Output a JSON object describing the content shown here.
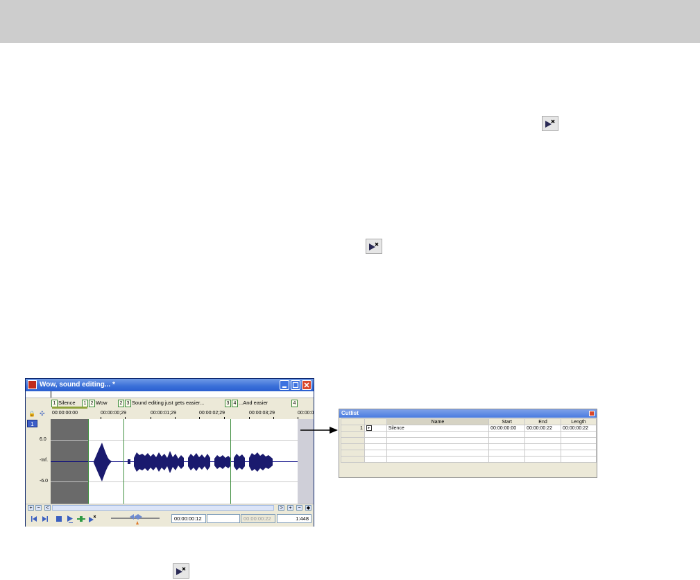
{
  "toolbar_icon": "play-with-x-icon",
  "editor": {
    "title": "Wow, sound editing... *",
    "track_number": "1",
    "regions": [
      {
        "nums": [
          "1"
        ],
        "label": "Silence"
      },
      {
        "nums": [
          "1",
          "2"
        ],
        "label": "Wow"
      },
      {
        "nums": [
          "2",
          "3"
        ],
        "label": "Sound editing just gets easier..."
      },
      {
        "nums": [
          "3",
          "4"
        ],
        "label": "...And easier"
      },
      {
        "nums": [
          "4"
        ],
        "label": ""
      }
    ],
    "timeline_labels": [
      "00:00:00:00",
      "00:00:00;29",
      "00:00:01;29",
      "00:00:02;29",
      "00:00:03;29",
      "00:00:0"
    ],
    "db_labels": [
      "6.0",
      "-Inf.",
      "-6.0"
    ],
    "transport": {
      "position": "00:00:00:12",
      "selection_end": "00:00:00:22",
      "ratio": "1:448"
    },
    "scroll_buttons": [
      "+",
      "−",
      "<",
      ">",
      "+",
      "−"
    ]
  },
  "cutlist": {
    "title": "Cutlist",
    "headers": [
      "",
      "",
      "Name",
      "Start",
      "End",
      "Length"
    ],
    "rows": [
      {
        "index": "1",
        "name": "Silence",
        "start": "00:00:00:00",
        "end": "00:00:00:22",
        "length": "00:00:00:22"
      },
      {
        "index": "",
        "name": "",
        "start": "",
        "end": "",
        "length": ""
      },
      {
        "index": "",
        "name": "",
        "start": "",
        "end": "",
        "length": ""
      },
      {
        "index": "",
        "name": "",
        "start": "",
        "end": "",
        "length": ""
      },
      {
        "index": "",
        "name": "",
        "start": "",
        "end": "",
        "length": ""
      },
      {
        "index": "",
        "name": "",
        "start": "",
        "end": "",
        "length": ""
      }
    ]
  },
  "colors": {
    "waveform": "#1a1a6e",
    "marker": "#3d8e3d",
    "selection": "#6a6a6a"
  }
}
